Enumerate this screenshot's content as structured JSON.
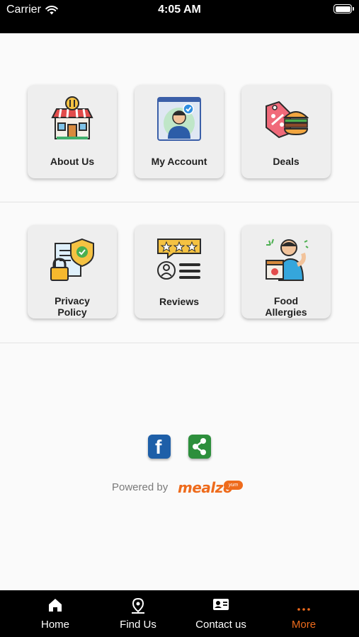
{
  "status": {
    "carrier": "Carrier",
    "time": "4:05 AM"
  },
  "menu": {
    "row1": [
      {
        "label": "About Us",
        "icon": "restaurant-icon"
      },
      {
        "label": "My Account",
        "icon": "user-account-icon"
      },
      {
        "label": "Deals",
        "icon": "deals-tag-icon"
      }
    ],
    "row2": [
      {
        "label": "Privacy Policy",
        "icon": "privacy-shield-icon"
      },
      {
        "label": "Reviews",
        "icon": "reviews-stars-icon"
      },
      {
        "label": "Food Allergies",
        "icon": "allergy-icon"
      }
    ]
  },
  "social": {
    "facebook": "f"
  },
  "footer": {
    "powered_by": "Powered by",
    "brand": "mealzo",
    "brand_badge": "yum"
  },
  "tabbar": {
    "items": [
      {
        "label": "Home",
        "icon": "home-icon"
      },
      {
        "label": "Find Us",
        "icon": "location-pin-icon"
      },
      {
        "label": "Contact us",
        "icon": "contact-card-icon"
      },
      {
        "label": "More",
        "icon": "more-dots-icon"
      }
    ],
    "active": "More",
    "active_color": "#ee6b1c"
  }
}
